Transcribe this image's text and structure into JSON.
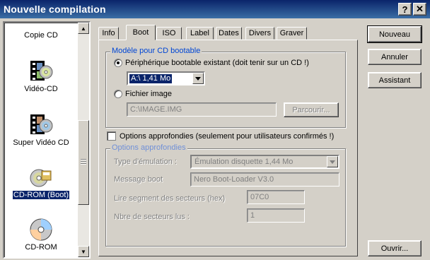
{
  "window": {
    "title": "Nouvelle compilation",
    "help_label": "?",
    "close_label": "✕"
  },
  "left_list": {
    "items": [
      {
        "label": "Copie CD",
        "icon": "copy-cd-icon"
      },
      {
        "label": "Vidéo-CD",
        "icon": "video-cd-icon"
      },
      {
        "label": "Super Vidéo CD",
        "icon": "super-video-cd-icon"
      },
      {
        "label": "CD-ROM (Boot)",
        "icon": "cdrom-boot-icon",
        "selected": true
      },
      {
        "label": "CD-ROM",
        "icon": "cdrom-icon"
      }
    ],
    "scroll_up": "▲",
    "scroll_down": "▼"
  },
  "tabs": [
    {
      "label": "Info"
    },
    {
      "label": "Boot",
      "active": true
    },
    {
      "label": "ISO"
    },
    {
      "label": "Label"
    },
    {
      "label": "Dates"
    },
    {
      "label": "Divers"
    },
    {
      "label": "Graver"
    }
  ],
  "boot_group": {
    "legend": "Modèle pour CD bootable",
    "radio_device": "Périphérique bootable existant (doit tenir sur un CD !)",
    "device_value": "A:\\  1,41 Mo",
    "radio_image": "Fichier image",
    "image_path": "C:\\IMAGE.IMG",
    "browse_label": "Parcourir..."
  },
  "advanced": {
    "checkbox_label": "Options approfondies (seulement pour utilisateurs confirmés !)",
    "legend": "Options approfondies",
    "emulation_label": "Type d'émulation :",
    "emulation_value": "Émulation disquette 1,44 Mo",
    "message_label": "Message boot",
    "message_value": "Nero Boot-Loader V3.0",
    "segment_label": "Lire segment des secteurs (hex)",
    "segment_value": "07C0",
    "sectors_label": "Nbre de secteurs lus :",
    "sectors_value": "1"
  },
  "buttons": {
    "new": "Nouveau",
    "cancel": "Annuler",
    "wizard": "Assistant",
    "open": "Ouvrir..."
  },
  "colors": {
    "titlebar": "#0a246a",
    "face": "#d4d0c8",
    "legend": "#0046d5"
  }
}
